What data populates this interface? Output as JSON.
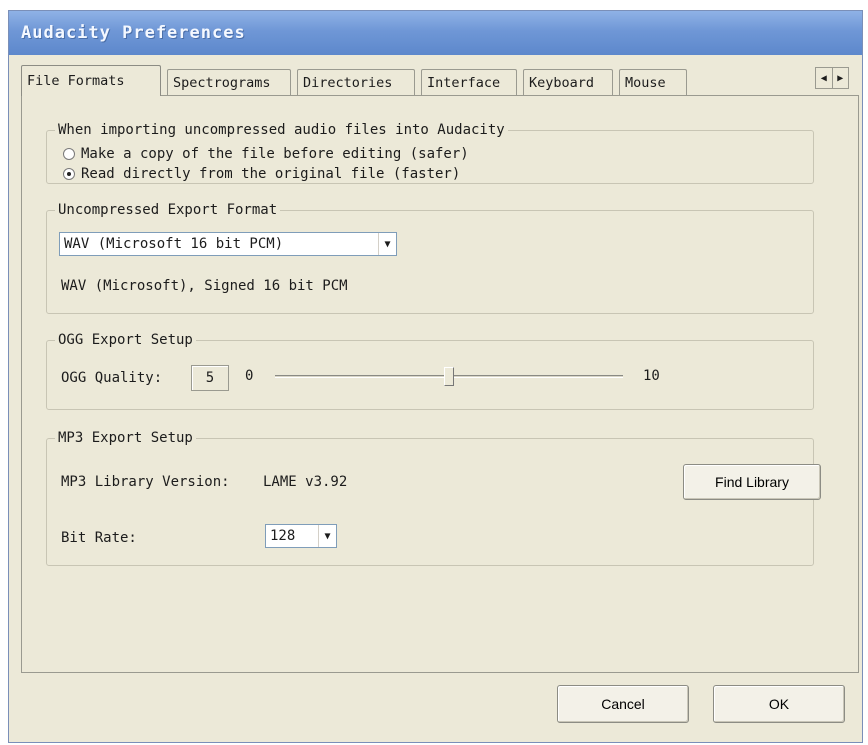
{
  "window": {
    "title": "Audacity Preferences"
  },
  "tabs": [
    {
      "label": "File Formats",
      "active": true
    },
    {
      "label": "Spectrograms",
      "active": false
    },
    {
      "label": "Directories",
      "active": false
    },
    {
      "label": "Interface",
      "active": false
    },
    {
      "label": "Keyboard",
      "active": false
    },
    {
      "label": "Mouse",
      "active": false
    }
  ],
  "tab_scroll": {
    "left": "◀",
    "right": "▶"
  },
  "import_group": {
    "legend": "When importing uncompressed audio files into Audacity",
    "options": [
      {
        "label": "Make a copy of the file before editing (safer)",
        "checked": false
      },
      {
        "label": "Read directly from the original file (faster)",
        "checked": true
      }
    ]
  },
  "export_group": {
    "legend": "Uncompressed Export Format",
    "format_selected": "WAV (Microsoft 16 bit PCM)",
    "format_description": "WAV (Microsoft), Signed 16 bit PCM"
  },
  "ogg_group": {
    "legend": "OGG Export Setup",
    "quality_label": "OGG Quality:",
    "quality_value": "5",
    "slider_min_label": "0",
    "slider_max_label": "10",
    "slider_level": 0.5
  },
  "mp3_group": {
    "legend": "MP3 Export Setup",
    "library_version_label": "MP3 Library Version:",
    "library_version_value": "LAME v3.92",
    "find_library_label": "Find Library",
    "bitrate_label": "Bit Rate:",
    "bitrate_selected": "128"
  },
  "footer": {
    "cancel_label": "Cancel",
    "ok_label": "OK"
  },
  "icons": {
    "dropdown": "chevron-down-icon",
    "radio": "radio-icon"
  },
  "colors": {
    "title_bar": "#6f97d6",
    "window_bg": "#ece9d8",
    "input_border": "#7f9db9"
  }
}
